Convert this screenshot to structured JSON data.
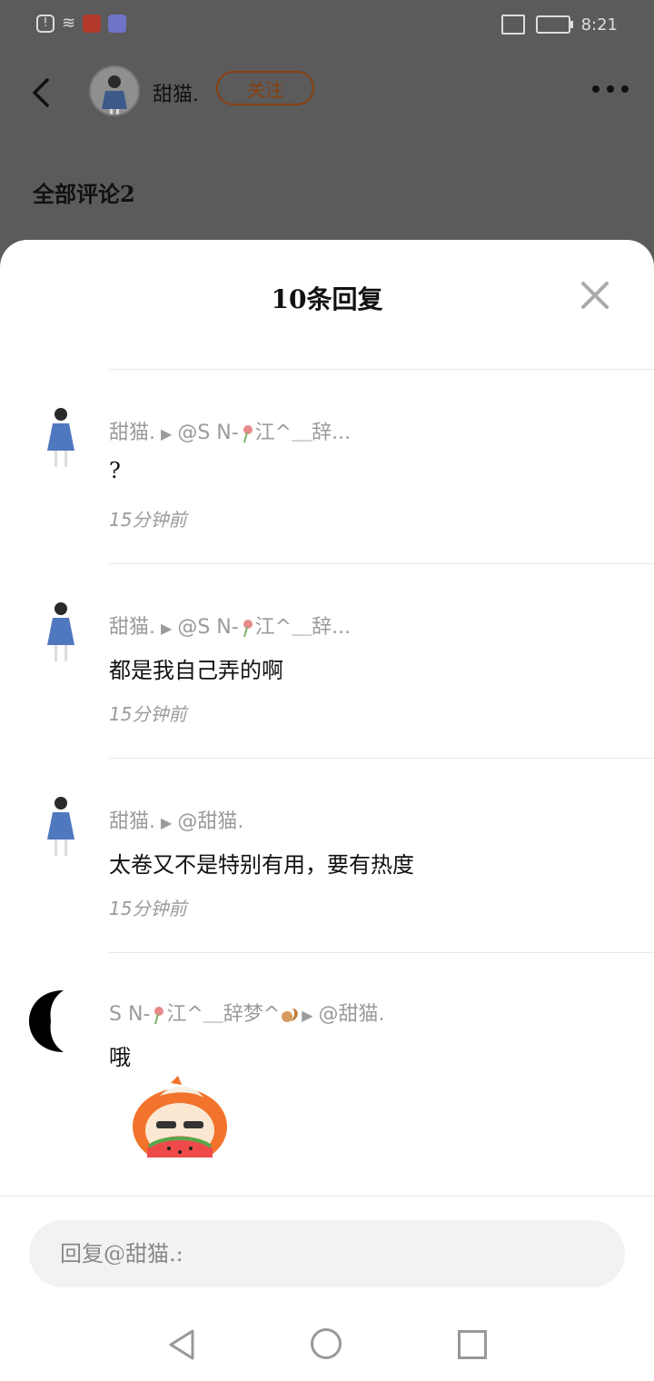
{
  "status_bar": {
    "time": "8:21",
    "left_icons": [
      "alert-icon",
      "wifi-icon",
      "app-notification-icon",
      "music-app-icon"
    ],
    "right_icons": [
      "cast-icon",
      "battery-charging-icon"
    ]
  },
  "header": {
    "username": "甜猫.",
    "follow_label": "关注",
    "all_comments_label": "全部评论2"
  },
  "sheet": {
    "title": "10条回复",
    "close_icon": "close-icon"
  },
  "comments": [
    {
      "author": "甜猫.",
      "target_prefix": "@S N-",
      "target_suffix": "江^＿辞...",
      "text": "?",
      "time": "15分钟前"
    },
    {
      "author": "甜猫.",
      "target_prefix": "@S N-",
      "target_suffix": "江^＿辞...",
      "text": "都是我自己弄的啊",
      "time": "15分钟前"
    },
    {
      "author": "甜猫.",
      "target_prefix": "@甜猫.",
      "target_suffix": "",
      "text": "太卷又不是特别有用，要有热度",
      "time": "15分钟前"
    },
    {
      "author_prefix": "S N-",
      "author_suffix": "江^＿辞梦^",
      "target_prefix": "@甜猫.",
      "text": "哦",
      "time": ""
    }
  ],
  "input": {
    "placeholder": "回复@甜猫.:"
  },
  "colors": {
    "overlay_bg": "#5b5b5b",
    "follow_accent": "#8a3f10",
    "meta_text": "#9b9b9b"
  }
}
